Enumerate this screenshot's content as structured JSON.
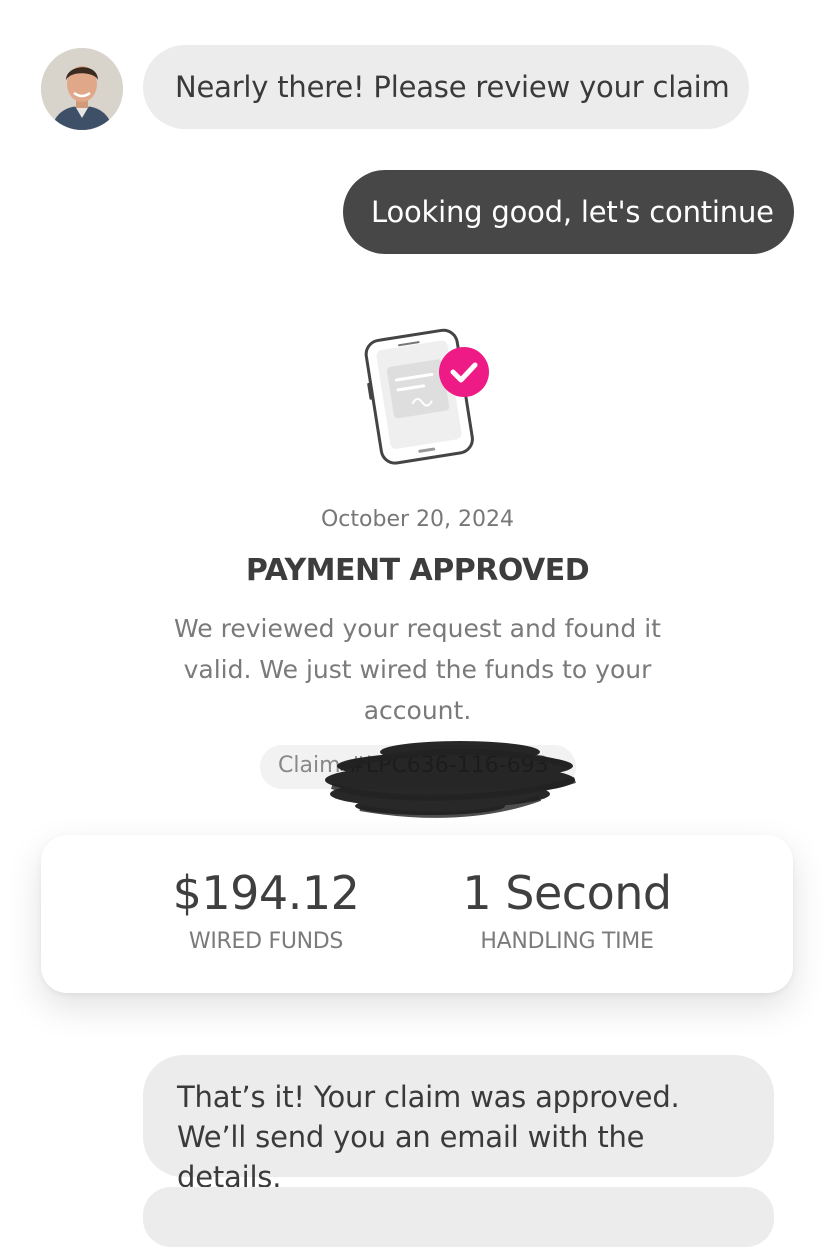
{
  "chat": {
    "agent_message_1": "Nearly there! Please review your claim",
    "user_message_1": "Looking good, let's continue",
    "agent_message_2": "That’s it! Your claim was approved. We’ll send you an email with the details."
  },
  "confirmation": {
    "date": "October 20, 2024",
    "title": "PAYMENT APPROVED",
    "description": "We reviewed your request and found it valid. We just wired the funds to your account.",
    "claim_label": "Claim #LPC636-116-693",
    "illustration_icon": "phone-check-icon",
    "accent_color": "#ee1a86"
  },
  "stats": {
    "amount_value": "$194.12",
    "amount_label": "WIRED FUNDS",
    "time_value": "1 Second",
    "time_label": "HANDLING TIME"
  }
}
